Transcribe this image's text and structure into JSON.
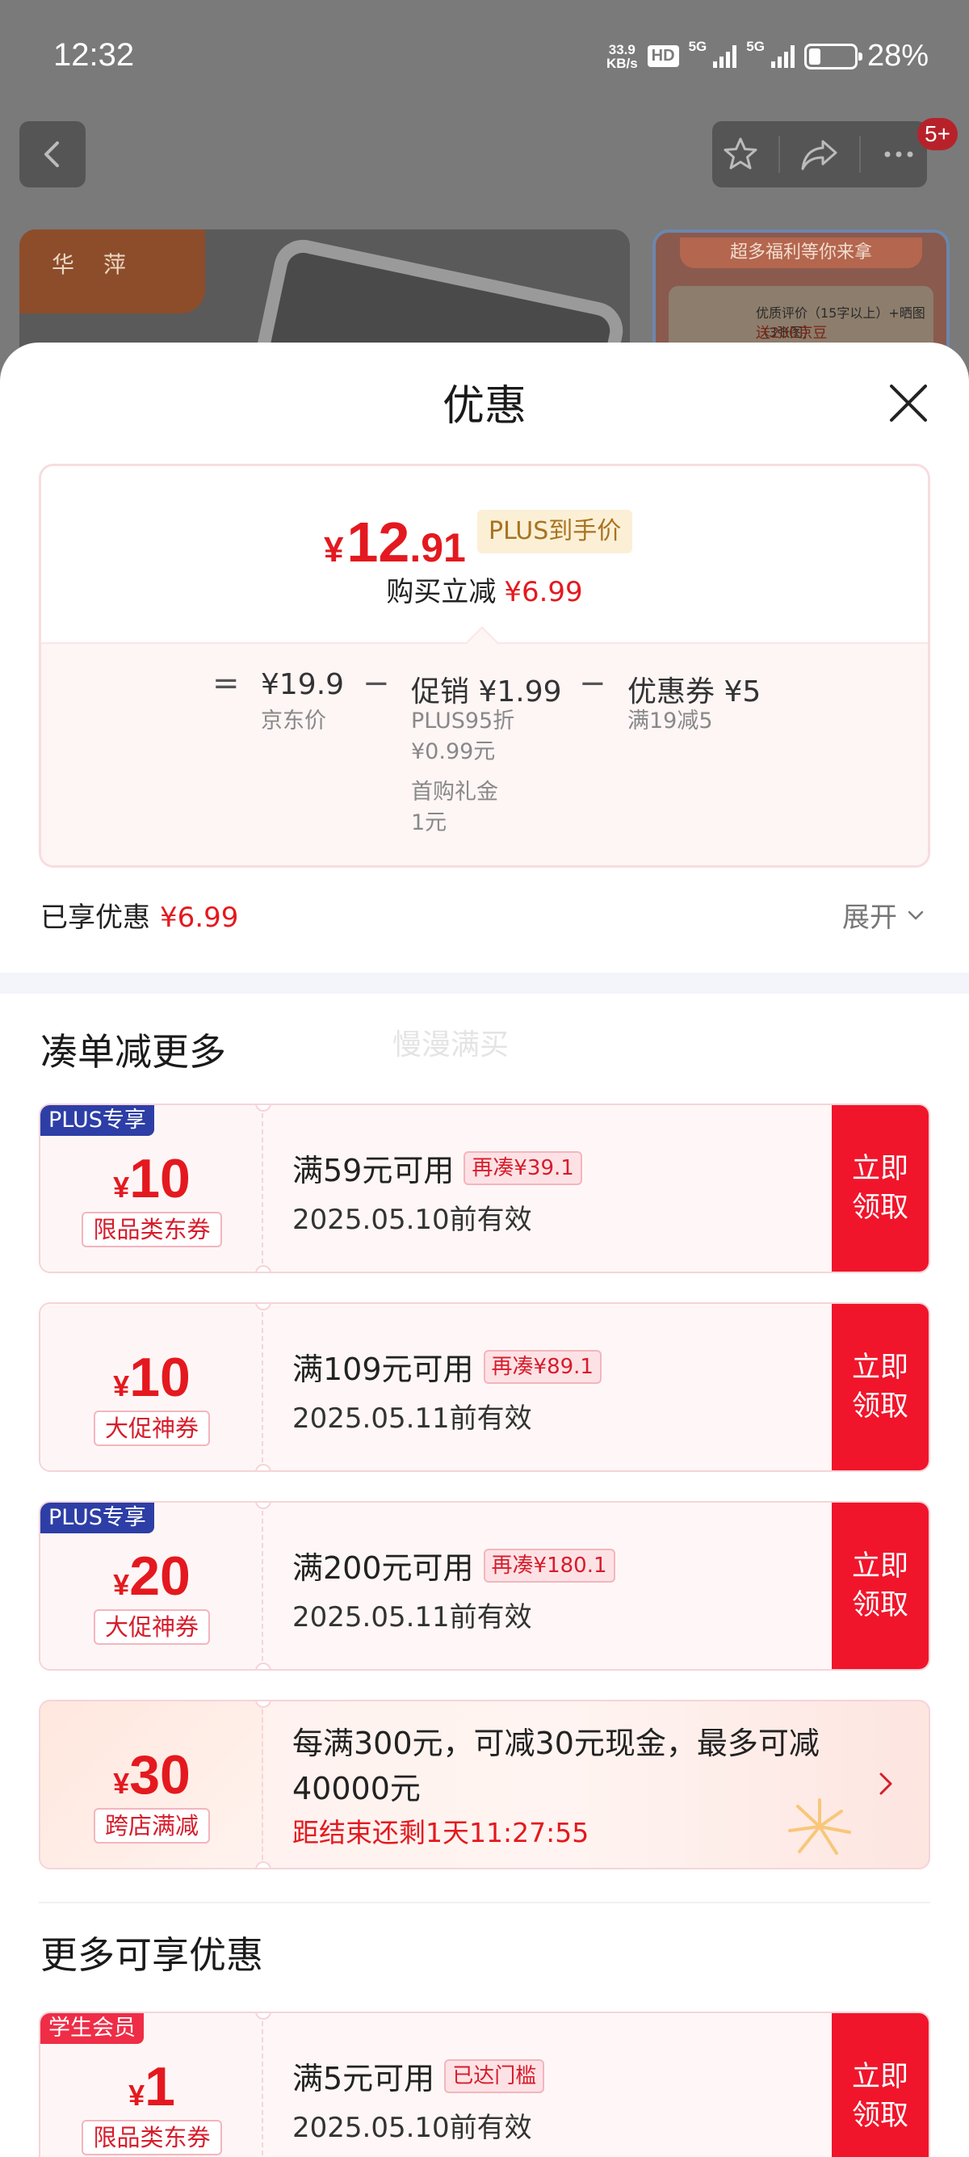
{
  "status_bar": {
    "time": "12:32",
    "net_speed_top": "33.9",
    "net_speed_bottom": "KB/s",
    "hd": "HD",
    "sig1": "5G",
    "sig2": "5G",
    "battery": "28%"
  },
  "nav": {
    "badge": "5+"
  },
  "background": {
    "logo_text": "华萍",
    "banner": "超多福利等你来拿",
    "card_line1": "优质评价（15字以上）+晒图（3张图）",
    "card_line2": "送200京豆"
  },
  "sheet": {
    "title": "优惠",
    "price": {
      "currency": "¥",
      "integer": "12",
      "decimal": ".91",
      "tag": "PLUS到手价"
    },
    "buy_reduce": {
      "label": "购买立减",
      "value": "¥6.99"
    },
    "formula": {
      "eq": "=",
      "minus": "−",
      "jd_price": "¥19.9",
      "jd_price_label": "京东价",
      "promo": "促销 ¥1.99",
      "promo_detail1": "PLUS95折",
      "promo_detail2": "¥0.99元",
      "promo_detail3": "首购礼金",
      "promo_detail4": "1元",
      "coupon": "优惠券 ¥5",
      "coupon_detail": "满19减5"
    },
    "enjoyed": {
      "label": "已享优惠",
      "value": "¥6.99"
    },
    "expand": "展开",
    "section1_title": "凑单减更多",
    "watermark": "慢漫满买",
    "coupons": [
      {
        "tag": "PLUS专享",
        "currency": "¥",
        "amount": "10",
        "type": "限品类东券",
        "condition": "满59元可用",
        "more": "再凑¥39.1",
        "valid": "2025.05.10前有效",
        "button": "立即领取"
      },
      {
        "tag": "",
        "currency": "¥",
        "amount": "10",
        "type": "大促神券",
        "condition": "满109元可用",
        "more": "再凑¥89.1",
        "valid": "2025.05.11前有效",
        "button": "立即领取"
      },
      {
        "tag": "PLUS专享",
        "currency": "¥",
        "amount": "20",
        "type": "大促神券",
        "condition": "满200元可用",
        "more": "再凑¥180.1",
        "valid": "2025.05.11前有效",
        "button": "立即领取"
      }
    ],
    "promo": {
      "currency": "¥",
      "amount": "30",
      "type": "跨店满减",
      "description": "每满300元，可减30元现金，最多可减40000元",
      "countdown": "距结束还剩1天11:27:55"
    },
    "section2_title": "更多可享优惠",
    "student_coupon": {
      "tag": "学生会员",
      "currency": "¥",
      "amount": "1",
      "type": "限品类东券",
      "condition": "满5元可用",
      "more": "已达门槛",
      "valid": "2025.05.10前有效",
      "button": "立即领取"
    }
  },
  "colors": {
    "accent": "#e4191f",
    "button": "#f0152b",
    "plus_tag": "#2d3ea6",
    "student_tag": "#ef2d47"
  }
}
